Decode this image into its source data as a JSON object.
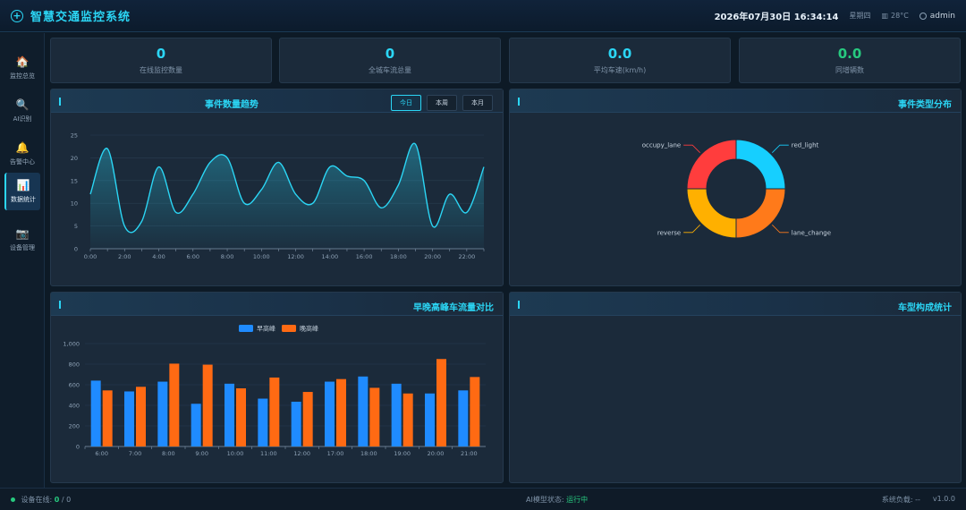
{
  "header": {
    "title": "智慧交通监控系统",
    "datetime": "2026年07月30日 16:34:14",
    "weekday": "星期四",
    "weather": "28°C",
    "user": "admin"
  },
  "sidebar": {
    "items": [
      {
        "label": "监控总览",
        "icon": "home-icon",
        "glyph": "🏠"
      },
      {
        "label": "AI识别",
        "icon": "search-icon",
        "glyph": "🔍"
      },
      {
        "label": "告警中心",
        "icon": "bell-icon",
        "glyph": "🔔"
      },
      {
        "label": "数据统计",
        "icon": "chart-icon",
        "glyph": "📊",
        "active": true
      },
      {
        "label": "设备管理",
        "icon": "camera-icon",
        "glyph": "📷"
      }
    ]
  },
  "stats": [
    {
      "value": "0",
      "label": "在线监控数量"
    },
    {
      "value": "0",
      "label": "全城车流总量"
    },
    {
      "value": "0.0",
      "label": "平均车速(km/h)"
    },
    {
      "value": "0.0",
      "label": "同增辆数"
    }
  ],
  "panels": {
    "trend": {
      "title": "事件数量趋势",
      "tabs": [
        "今日",
        "本周",
        "本月"
      ],
      "active_tab": "今日"
    },
    "types": {
      "title": "事件类型分布"
    },
    "peak": {
      "title": "早晚高峰车流量对比"
    },
    "vehicle": {
      "title": "车型构成统计"
    }
  },
  "chart_data": [
    {
      "type": "area",
      "x": [
        "0:00",
        "1:00",
        "2:00",
        "3:00",
        "4:00",
        "5:00",
        "6:00",
        "7:00",
        "8:00",
        "9:00",
        "10:00",
        "11:00",
        "12:00",
        "13:00",
        "14:00",
        "15:00",
        "16:00",
        "17:00",
        "18:00",
        "19:00",
        "20:00",
        "21:00",
        "22:00",
        "23:00"
      ],
      "xticks": [
        "0:00",
        "2:00",
        "4:00",
        "6:00",
        "8:00",
        "10:00",
        "12:00",
        "14:00",
        "16:00",
        "18:00",
        "20:00",
        "22:00"
      ],
      "values": [
        12,
        22,
        5,
        6,
        18,
        8,
        12,
        19,
        20,
        10,
        13,
        19,
        12,
        10,
        18,
        16,
        15,
        9,
        14,
        23,
        5,
        12,
        8,
        18
      ],
      "ylim": [
        0,
        25
      ],
      "yticks": [
        0,
        5,
        10,
        15,
        20,
        25
      ],
      "color": "#2bd6f5",
      "grid": true
    },
    {
      "type": "pie",
      "donut": true,
      "slices": [
        {
          "label": "red_light",
          "value": 25,
          "color": "#16cfff"
        },
        {
          "label": "lane_change",
          "value": 25,
          "color": "#ff7a1a"
        },
        {
          "label": "reverse",
          "value": 25,
          "color": "#ffb000"
        },
        {
          "label": "occupy_lane",
          "value": 25,
          "color": "#ff3d3d"
        }
      ]
    },
    {
      "type": "bar",
      "categories": [
        "6:00",
        "7:00",
        "8:00",
        "9:00",
        "10:00",
        "11:00",
        "12:00",
        "17:00",
        "18:00",
        "19:00",
        "20:00",
        "21:00"
      ],
      "series": [
        {
          "name": "早高峰",
          "color": "#1f8bff",
          "values": [
            640,
            535,
            630,
            415,
            610,
            465,
            435,
            630,
            680,
            610,
            515,
            545
          ]
        },
        {
          "name": "晚高峰",
          "color": "#ff6a13",
          "values": [
            545,
            580,
            805,
            795,
            565,
            670,
            530,
            655,
            570,
            515,
            850,
            675
          ]
        }
      ],
      "ylim": [
        0,
        1000
      ],
      "yticks": [
        "0",
        "200",
        "400",
        "600",
        "800",
        "1,000"
      ],
      "legend": "top-center",
      "grid": true
    }
  ],
  "footer": {
    "online_label": "设备在线:",
    "online_count": "0",
    "online_total": "/ 0",
    "ai_label": "AI模型状态:",
    "ai_status": "运行中",
    "load_label": "系统负载: --",
    "version": "v1.0.0"
  }
}
